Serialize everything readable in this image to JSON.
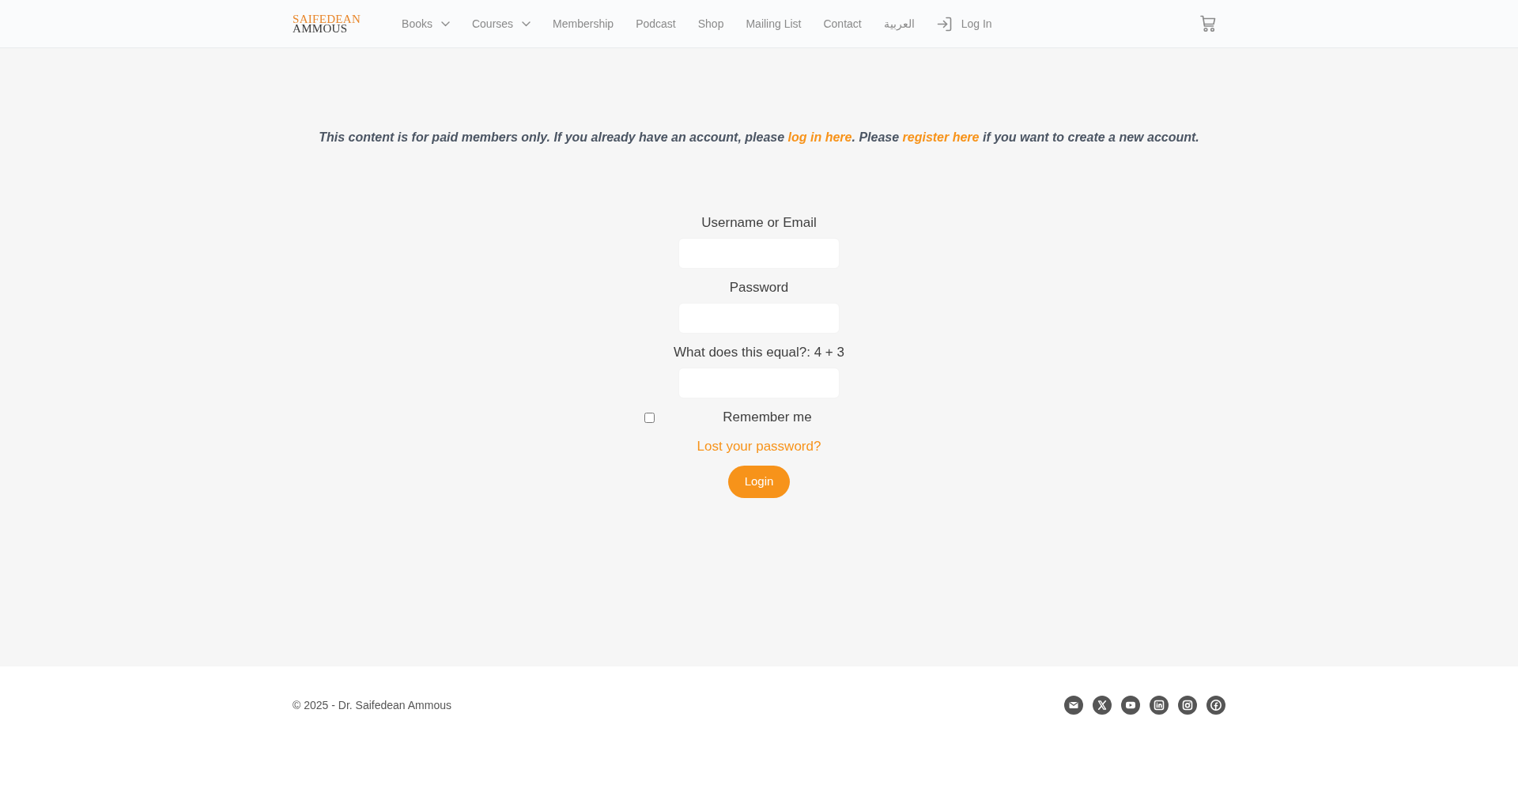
{
  "header": {
    "logo": {
      "line_1": "SAIFEDEAN",
      "line_2": "AMMOUS"
    },
    "nav": [
      {
        "label": "Books",
        "dropdown": true
      },
      {
        "label": "Courses",
        "dropdown": true
      },
      {
        "label": "Membership",
        "dropdown": false
      },
      {
        "label": "Podcast",
        "dropdown": false
      },
      {
        "label": "Shop",
        "dropdown": false
      },
      {
        "label": "Mailing List",
        "dropdown": false
      },
      {
        "label": "Contact",
        "dropdown": false
      },
      {
        "label": "العربية",
        "dropdown": false
      }
    ],
    "login": {
      "label": "Log In"
    }
  },
  "notice": [
    {
      "kind": "text",
      "text": "This content is for paid members only. If you already have an account, please "
    },
    {
      "kind": "link",
      "text": "log in here"
    },
    {
      "kind": "text",
      "text": ". Please "
    },
    {
      "kind": "link",
      "text": "register here"
    },
    {
      "kind": "text",
      "text": " if you want to create a new account."
    }
  ],
  "form": {
    "fields": [
      {
        "label": "Username or Email"
      },
      {
        "label": "Password"
      },
      {
        "label": "What does this equal?: 4 + 3"
      }
    ],
    "remember": {
      "label": "Remember me",
      "checked": false
    },
    "lost_password": "Lost your password?",
    "submit": "Login"
  },
  "footer": {
    "copyright": "© 2025 - Dr. Saifedean Ammous",
    "social": [
      {
        "kind": "email"
      },
      {
        "kind": "x"
      },
      {
        "kind": "youtube"
      },
      {
        "kind": "linkedin"
      },
      {
        "kind": "instagram"
      },
      {
        "kind": "facebook"
      }
    ]
  }
}
